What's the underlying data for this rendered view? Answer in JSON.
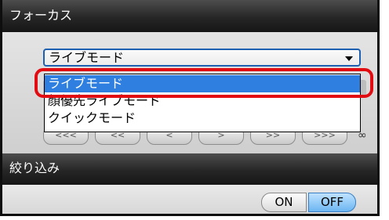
{
  "focus_section": {
    "title": "フォーカス",
    "mode_select": {
      "value": "ライブモード",
      "options": [
        "ライブモード",
        "顔優先ライブモード",
        "クイックモード"
      ],
      "selected_index": 0
    },
    "step_buttons": [
      "<<<",
      "<<",
      "<",
      ">",
      ">>",
      ">>>"
    ],
    "step_aside": "∞"
  },
  "refine_section": {
    "title": "絞り込み",
    "on_label": "ON",
    "off_label": "OFF",
    "active": "OFF"
  },
  "colors": {
    "accent": "#2f7fe0",
    "highlight": "#e30b12"
  }
}
